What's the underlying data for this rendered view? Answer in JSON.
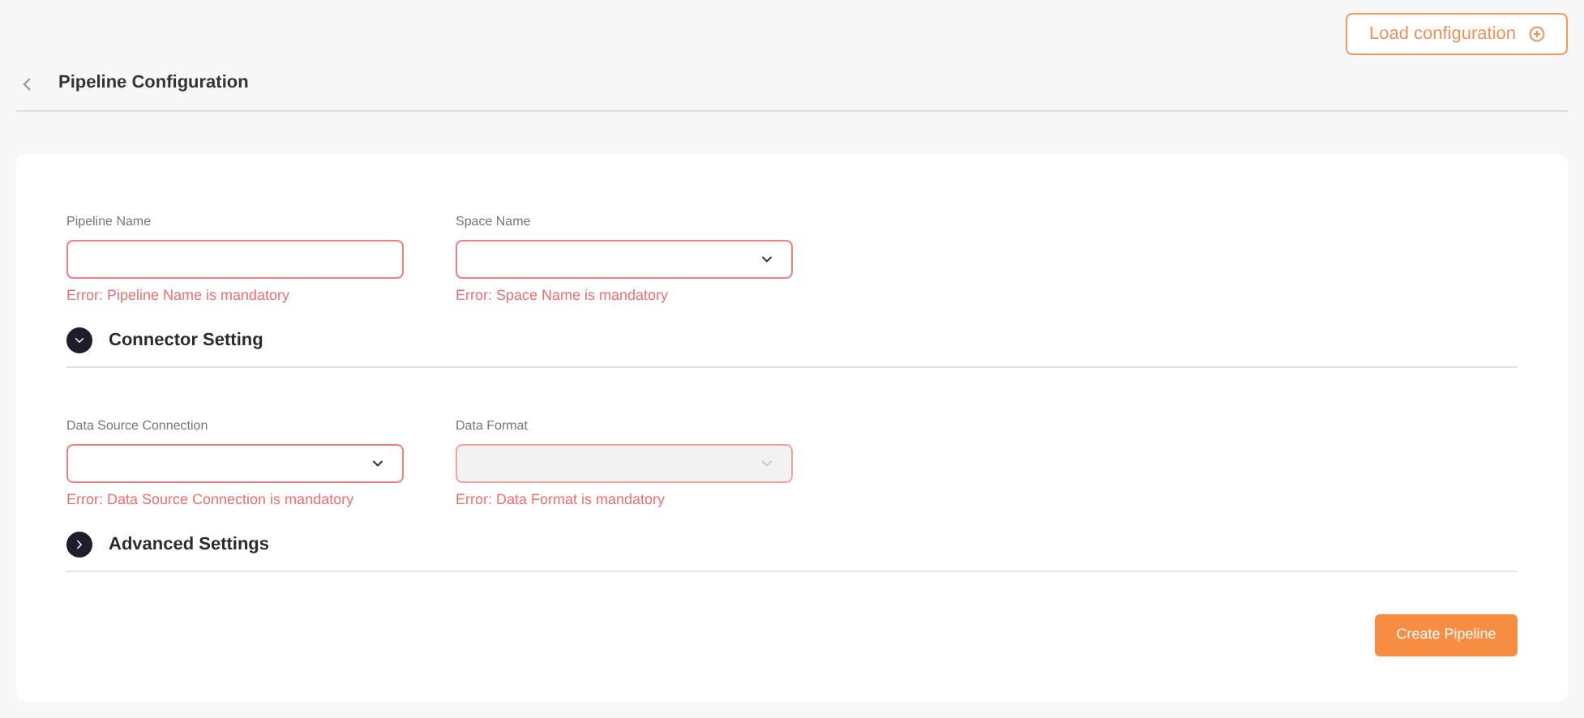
{
  "load_button": {
    "label": "Load configuration"
  },
  "header": {
    "title": "Pipeline Configuration"
  },
  "groups": [
    {
      "fields": [
        {
          "label": "Pipeline Name",
          "kind": "text",
          "disabled": false,
          "error": "Error: Pipeline Name is mandatory"
        },
        {
          "label": "Space Name",
          "kind": "select",
          "disabled": false,
          "error": "Error: Space Name is mandatory"
        }
      ],
      "section": {
        "title": "Connector Setting",
        "expanded": true
      }
    },
    {
      "fields": [
        {
          "label": "Data Source Connection",
          "kind": "select",
          "disabled": false,
          "error": "Error: Data Source Connection is mandatory"
        },
        {
          "label": "Data Format",
          "kind": "select",
          "disabled": true,
          "error": "Error: Data Format is mandatory"
        }
      ],
      "section": {
        "title": "Advanced Settings",
        "expanded": false
      }
    }
  ],
  "submit_button": {
    "label": "Create Pipeline"
  }
}
